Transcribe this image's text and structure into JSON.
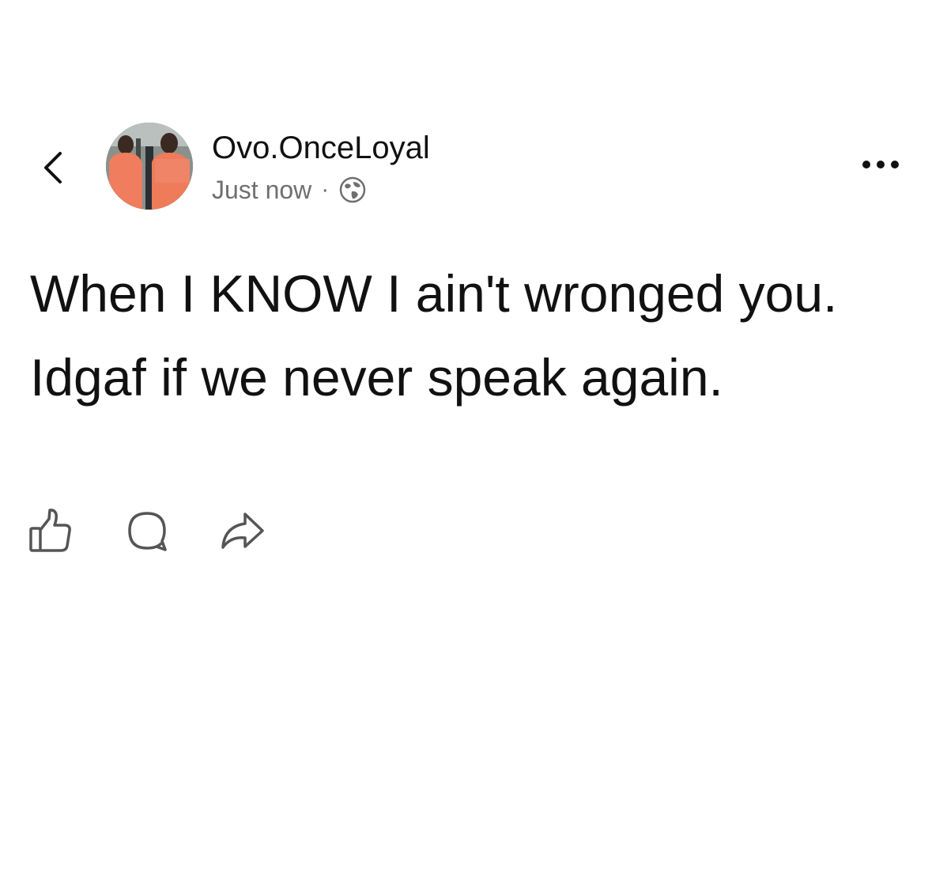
{
  "post": {
    "author": "Ovo.OnceLoyal",
    "timestamp": "Just now",
    "separator": "·",
    "text": "When I KNOW I ain't wronged you. Idgaf if we never speak again."
  },
  "icons": {
    "back": "chevron-left-icon",
    "privacy": "globe-icon",
    "more": "more-horizontal-icon",
    "like": "thumbs-up-icon",
    "comment": "comment-icon",
    "share": "share-icon"
  },
  "colors": {
    "text": "#111111",
    "muted": "#6f6f6f",
    "background": "#ffffff"
  }
}
